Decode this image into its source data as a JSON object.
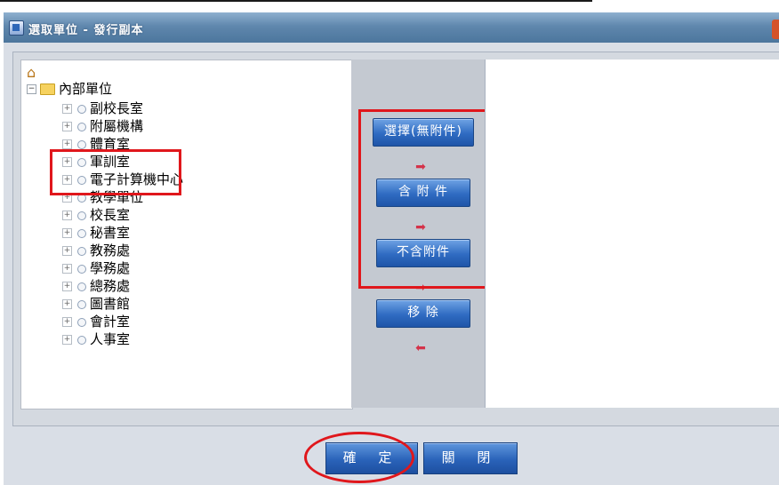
{
  "window": {
    "title": "選取單位 - 發行副本"
  },
  "tree": {
    "root_label": "內部單位",
    "children": [
      "副校長室",
      "附屬機構",
      "體育室",
      "軍訓室",
      "電子計算機中心",
      "教學單位",
      "校長室",
      "秘書室",
      "教務處",
      "學務處",
      "總務處",
      "圖書館",
      "會計室",
      "人事室"
    ]
  },
  "actions": {
    "select_no_attachment": "選擇(無附件)",
    "with_attachment": "含 附 件",
    "without_attachment": "不含附件",
    "remove": "移 除"
  },
  "footer": {
    "confirm": "確 定",
    "close": "關 閉"
  },
  "colors": {
    "highlight": "#e0171c",
    "button": "#2f6bc2",
    "titlebar": "#5f87ad"
  }
}
